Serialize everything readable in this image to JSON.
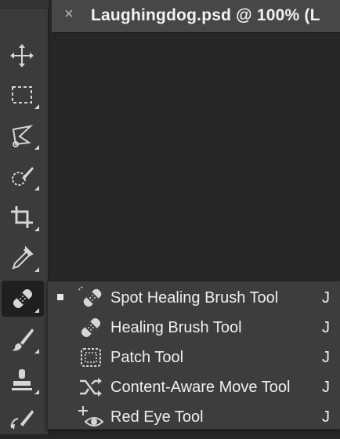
{
  "document_tab": {
    "close_glyph": "×",
    "title": "Laughingdog.psd @ 100% (L"
  },
  "toolbar": {
    "tools": [
      {
        "name": "move-tool",
        "icon": "move-icon"
      },
      {
        "name": "rectangular-marquee-tool",
        "icon": "marquee-icon"
      },
      {
        "name": "lasso-tool",
        "icon": "lasso-icon"
      },
      {
        "name": "quick-selection-tool",
        "icon": "quick-selection-icon"
      },
      {
        "name": "crop-tool",
        "icon": "crop-icon"
      },
      {
        "name": "eyedropper-tool",
        "icon": "eyedropper-icon"
      },
      {
        "name": "healing-tools",
        "icon": "bandage-icon",
        "active": true
      },
      {
        "name": "brush-tool",
        "icon": "brush-icon"
      },
      {
        "name": "clone-stamp-tool",
        "icon": "stamp-icon"
      },
      {
        "name": "history-brush-tool",
        "icon": "history-brush-icon"
      }
    ]
  },
  "flyout": {
    "items": [
      {
        "label": "Spot Healing Brush Tool",
        "shortcut": "J",
        "selected": true,
        "icon": "spot-healing-icon"
      },
      {
        "label": "Healing Brush Tool",
        "shortcut": "J",
        "selected": false,
        "icon": "healing-brush-icon"
      },
      {
        "label": "Patch Tool",
        "shortcut": "J",
        "selected": false,
        "icon": "patch-icon"
      },
      {
        "label": "Content-Aware Move Tool",
        "shortcut": "J",
        "selected": false,
        "icon": "content-aware-move-icon"
      },
      {
        "label": "Red Eye Tool",
        "shortcut": "J",
        "selected": false,
        "icon": "red-eye-icon"
      }
    ]
  },
  "colors": {
    "toolbar_bg": "#3b3b3b",
    "canvas_bg": "#262626",
    "tab_bg": "#474747",
    "menu_bg": "#3d3d3d",
    "icon_fg": "#d6d6d6"
  }
}
